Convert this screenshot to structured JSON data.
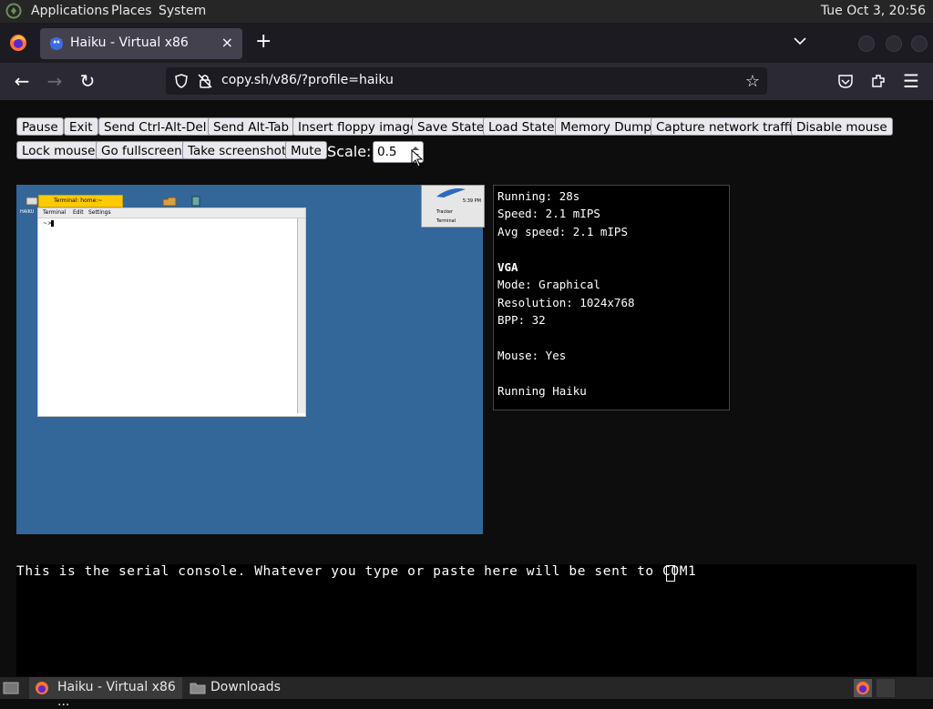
{
  "top_panel": {
    "menus": [
      "Applications",
      "Places",
      "System"
    ],
    "clock": "Tue Oct  3, 20:56"
  },
  "browser": {
    "tab": {
      "title": "Haiku - Virtual x86",
      "close": "×"
    },
    "new_tab": "+",
    "url": "copy.sh/v86/?profile=haiku",
    "nav": {
      "back": "←",
      "forward": "→",
      "reload": "↻",
      "star": "☆",
      "menu": "☰"
    }
  },
  "toolbar": {
    "buttons": [
      "Pause",
      "Exit",
      "Send Ctrl-Alt-Del",
      "Send Alt-Tab",
      "Insert floppy image",
      "Save State",
      "Load State",
      "Memory Dump",
      "Capture network traffic",
      "Disable mouse",
      "Lock mouse",
      "Go fullscreen",
      "Take screenshot",
      "Mute"
    ],
    "scale_label": "Scale:",
    "scale_value": "0.5"
  },
  "vm": {
    "desktop_color": "#336699",
    "terminal_title": "Terminal: home:~",
    "terminal_menu": [
      "Terminal",
      "Edit",
      "Settings"
    ],
    "deskbar": {
      "clock": "5:39 PM",
      "items": [
        "Tracker",
        "Terminal"
      ]
    },
    "disk_label": "HAIKU"
  },
  "stats": {
    "running": "Running: 28s",
    "speed": "Speed: 2.1 mIPS",
    "avg_speed": "Avg speed: 2.1 mIPS",
    "vga_heading": "VGA",
    "mode": "Mode: Graphical",
    "resolution": "Resolution: 1024x768",
    "bpp": "BPP: 32",
    "mouse": "Mouse: Yes",
    "running_os": "Running Haiku"
  },
  "serial": {
    "text": "This is the serial console. Whatever you type or paste here will be sent to COM1"
  },
  "taskbar": {
    "items": [
      "Haiku - Virtual x86 ...",
      "Downloads"
    ]
  },
  "colors": {
    "accent_tab": "#42414d",
    "vm_bg": "#336699",
    "haiku_yellow": "#ffcb00"
  }
}
